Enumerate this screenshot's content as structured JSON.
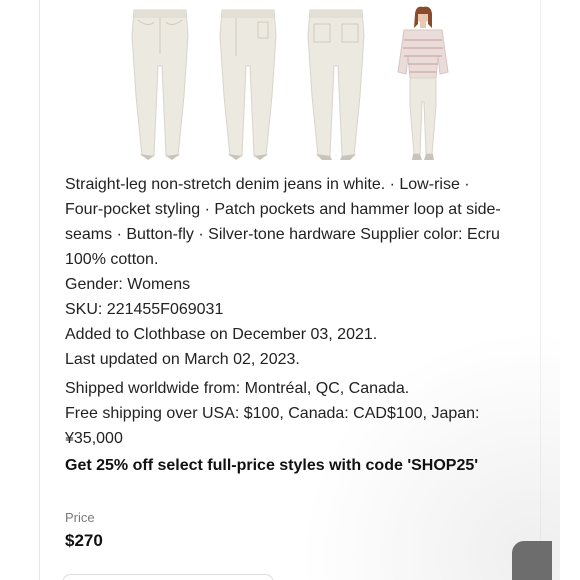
{
  "gallery": {
    "images": [
      {
        "name": "jeans-front-view",
        "kind": "product photo"
      },
      {
        "name": "jeans-side-view",
        "kind": "product photo"
      },
      {
        "name": "jeans-back-view",
        "kind": "product photo"
      },
      {
        "name": "model-wearing-jeans",
        "kind": "product photo"
      }
    ]
  },
  "description": {
    "lines": [
      "Straight-leg non-stretch denim jeans in white. · Low-rise ·",
      "Four-pocket styling · Patch pockets and hammer loop at side-",
      "seams · Button-fly · Silver-tone hardware Supplier color: Ecru",
      "100% cotton."
    ],
    "gender": "Gender: Womens",
    "sku": "SKU: 221455F069031",
    "added": "Added to Clothbase on December 03, 2021.",
    "updated": "Last updated on March 02, 2023."
  },
  "shipping": {
    "from": "Shipped worldwide from: Montréal, QC, Canada.",
    "free_line1": "Free shipping over USA: $100, Canada: CAD$100, Japan:",
    "free_line2": "¥35,000"
  },
  "promo": "Get 25% off select full-price styles with code 'SHOP25'",
  "price": {
    "label": "Price",
    "value": "$270"
  },
  "colors": {
    "denim": "#ece9e0",
    "denim_shadow": "#d8d4c9",
    "shoe": "#c9c4ba",
    "skin": "#e7c9b3",
    "hair": "#8a4a2c",
    "sweater": "#e9dcd9",
    "sweater_stripe": "#c79b9b"
  }
}
